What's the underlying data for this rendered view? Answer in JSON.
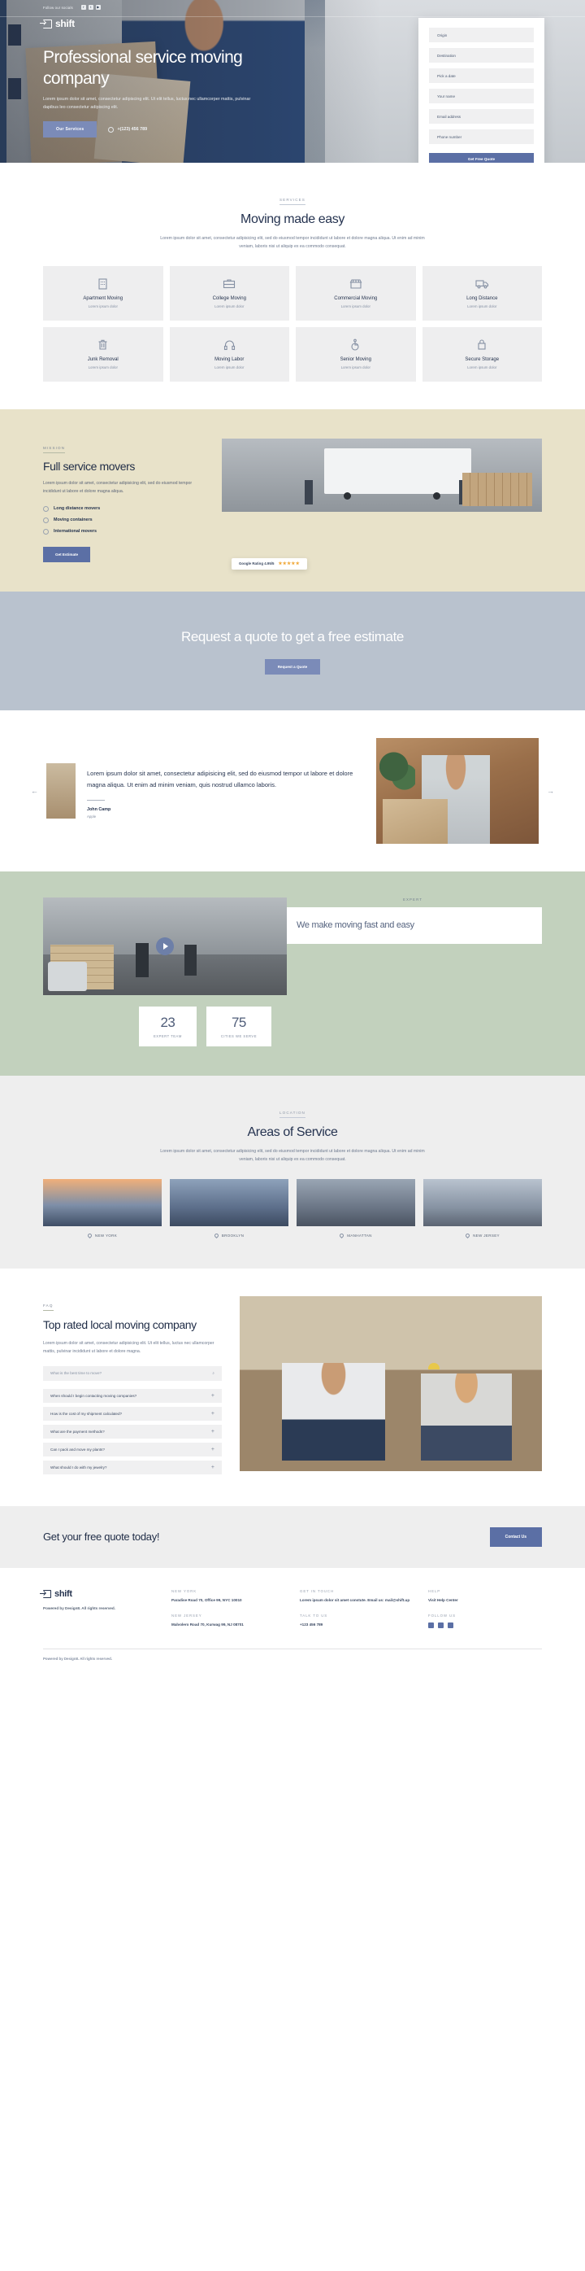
{
  "topbar": {
    "follow_label": "Follow our socials",
    "socials": [
      "f",
      "t",
      "y"
    ]
  },
  "brand": {
    "name": "shift"
  },
  "hero": {
    "title": "Professional service moving company",
    "paragraph": "Lorem ipsum dolor sit amet, consectetur adipiscing elit. Ut elit tellus, luctus nec ullamcorper mattis, pulvinar dapibus leo consectetur adipiscing elit.",
    "cta": "Our Services",
    "phone": "+(123) 456 789"
  },
  "quote_form": {
    "fields": [
      {
        "placeholder": "Origin"
      },
      {
        "placeholder": "Destination"
      },
      {
        "placeholder": "Pick a date"
      },
      {
        "placeholder": "Your name"
      },
      {
        "placeholder": "Email address"
      },
      {
        "placeholder": "Phone number"
      }
    ],
    "submit": "Get Free Quote"
  },
  "services": {
    "eyebrow": "SERVICES",
    "title": "Moving made easy",
    "lead": "Lorem ipsum dolor sit amet, consectetur adipisicing elit, sed do eiusmod tempor incididunt ut labore et dolore magna aliqua. Ut enim ad minim veniam, laboris nisi ut aliquip ex ea commodo consequat.",
    "cards": [
      {
        "icon": "building-icon",
        "title": "Apartment Moving",
        "sub": "Lorem ipsum dolor"
      },
      {
        "icon": "briefcase-icon",
        "title": "College Moving",
        "sub": "Lorem ipsum dolor"
      },
      {
        "icon": "store-icon",
        "title": "Commercial Moving",
        "sub": "Lorem ipsum dolor"
      },
      {
        "icon": "truck-icon",
        "title": "Long Distance",
        "sub": "Lorem ipsum dolor"
      },
      {
        "icon": "trash-icon",
        "title": "Junk Removal",
        "sub": "Lorem ipsum dolor"
      },
      {
        "icon": "headset-icon",
        "title": "Moving Labor",
        "sub": "Lorem ipsum dolor"
      },
      {
        "icon": "accessibility-icon",
        "title": "Senior Moving",
        "sub": "Lorem ipsum dolor"
      },
      {
        "icon": "lock-icon",
        "title": "Secure Storage",
        "sub": "Lorem ipsum dolor"
      }
    ]
  },
  "mission": {
    "eyebrow": "MISSION",
    "title": "Full service movers",
    "paragraph": "Lorem ipsum dolor sit amet, consectetur adipisicing elit, sed do eiusmod tempor incididunt ut labore et dolore magna aliqua.",
    "list": [
      "Long distance movers",
      "Moving containers",
      "International movers"
    ],
    "cta": "Get Estimate",
    "rating_label": "Google Rating 4.95/5",
    "stars": "★★★★★",
    "bg_color": "#e8e2c9"
  },
  "quote_banner": {
    "title": "Request a quote to get a free estimate",
    "cta": "Request a Quote",
    "bg_color": "#b9c2ce"
  },
  "testimonial": {
    "quote": "Lorem ipsum dolor sit amet, consectetur adipisicing elit, sed do eiusmod tempor ut labore et dolore magna aliqua. Ut enim ad minim veniam, quis nostrud ullamco laboris.",
    "name": "John Camp",
    "role": "Apple",
    "prev": "←",
    "next": "→"
  },
  "expert": {
    "eyebrow": "EXPERT",
    "title": "We make moving fast and easy",
    "stats": [
      {
        "value": "23",
        "label": "EXPERT TEAM"
      },
      {
        "value": "75",
        "label": "CITIES WE SERVE"
      }
    ],
    "bg_color": "#c2d1bd"
  },
  "areas": {
    "eyebrow": "LOCATION",
    "title": "Areas of Service",
    "lead": "Lorem ipsum dolor sit amet, consectetur adipisicing elit, sed do eiusmod tempor incididunt ut labore et dolore magna aliqua. Ut enim ad minim veniam, laboris nisi ut aliquip ex ea commodo consequat.",
    "items": [
      {
        "label": "NEW YORK"
      },
      {
        "label": "BROOKLYN"
      },
      {
        "label": "MANHATTAN"
      },
      {
        "label": "NEW JERSEY"
      }
    ]
  },
  "faq": {
    "eyebrow": "FAQ",
    "title": "Top rated local moving company",
    "paragraph": "Lorem ipsum dolor sit amet, consectetur adipisicing elit. Ut elit tellus, luctus nec ullamcorper mattis, pulvinar incididunt ut labore et dolore magna.",
    "search_placeholder": "What is the best time to move?",
    "items": [
      "When should I begin contacting moving companies?",
      "How is the cost of my shipment calculated?",
      "What are the payment methods?",
      "Can I pack and move my plants?",
      "What should I do with my jewelry?"
    ]
  },
  "cta_strip": {
    "title": "Get your free quote today!",
    "button": "Contact Us"
  },
  "footer": {
    "brand": "shift",
    "copy": "Powered by Design8. All rights reserved.",
    "columns": [
      {
        "blocks": [
          {
            "head": "NEW YORK",
            "value": "Paradise Road 70, Office 99, NYC 10010"
          },
          {
            "head": "NEW JERSEY",
            "value": "Malvolero Road 70, Kurwag 99, NJ 08701"
          }
        ]
      },
      {
        "blocks": [
          {
            "head": "GET IN TOUCH",
            "value": "Lorem ipsum dolor sit amet constute. Email us: mail@shift.up"
          },
          {
            "head": "TALK TO US",
            "value": "+123 456 789"
          }
        ]
      },
      {
        "blocks": [
          {
            "head": "HELP",
            "value": "Visit Help Center"
          },
          {
            "head": "FOLLOW US",
            "value": ""
          }
        ]
      }
    ],
    "socials": [
      "f",
      "t",
      "y"
    ],
    "bottom": "Powered by Design8. All rights reserved."
  },
  "colors": {
    "accent": "#5b6fa5",
    "accent_light": "#7b8bb8",
    "dark": "#26344f"
  }
}
